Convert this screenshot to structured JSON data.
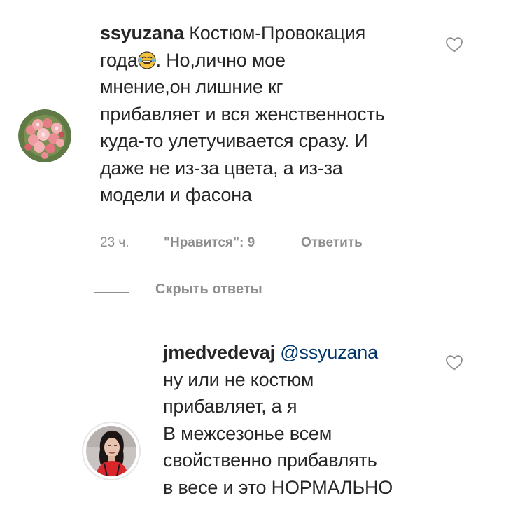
{
  "comment": {
    "username": "ssyuzana",
    "lines": [
      "Костюм-Провокация",
      "года",
      ". Но,лично мое",
      "мнение,он лишние кг",
      "прибавляет и вся женственность",
      "куда-то улетучивается сразу. И",
      "даже не из-за цвета, а из-за",
      "модели и фасона"
    ],
    "emoji": "face-with-tears-of-joy",
    "time": "23 ч.",
    "likes": "\"Нравится\": 9",
    "reply": "Ответить"
  },
  "replies_toggle": {
    "label": "Скрыть ответы"
  },
  "reply": {
    "username": "jmedvedevaj",
    "mention": "@ssyuzana",
    "lines": [
      "ну или не костюм",
      "прибавляет, а я",
      "В межсезонье всем",
      "свойственно прибавлять",
      "в весе и это НОРМАЛЬНО"
    ]
  },
  "colors": {
    "text": "#262626",
    "muted": "#8e8e8e",
    "mention": "#003569",
    "background": "#ffffff"
  }
}
